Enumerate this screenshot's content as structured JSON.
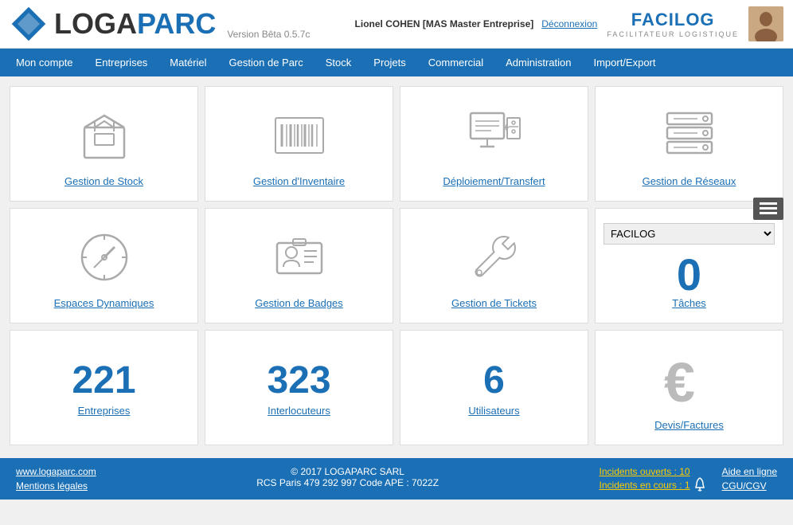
{
  "header": {
    "logo_text_loga": "LOGA",
    "logo_text_parc": "PARC",
    "version": "Version Bêta 0.5.7c",
    "user_name": "Lionel COHEN [MAS Master Entreprise]",
    "disconnect_label": "Déconnexion",
    "facilog_brand": "FACILOG",
    "facilog_sub": "FACILITATEUR LOGISTIQUE"
  },
  "nav": {
    "items": [
      "Mon compte",
      "Entreprises",
      "Matériel",
      "Gestion de Parc",
      "Stock",
      "Projets",
      "Commercial",
      "Administration",
      "Import/Export"
    ]
  },
  "tiles": {
    "row1": [
      {
        "label": "Gestion de Stock",
        "has_number": false
      },
      {
        "label": "Gestion d'Inventaire",
        "has_number": false
      },
      {
        "label": "Déploiement/Transfert",
        "has_number": false
      },
      {
        "label": "Gestion de Réseaux",
        "has_number": false
      }
    ],
    "row2": [
      {
        "label": "Espaces Dynamiques",
        "has_number": false
      },
      {
        "label": "Gestion de Badges",
        "has_number": false
      },
      {
        "label": "Gestion de Tickets",
        "has_number": false
      },
      {
        "label": "Tâches",
        "has_number": true,
        "number": "0",
        "dropdown": "FACILOG",
        "dropdown_options": [
          "FACILOG"
        ]
      }
    ],
    "row3": [
      {
        "label": "Entreprises",
        "has_number": true,
        "number": "221"
      },
      {
        "label": "Interlocuteurs",
        "has_number": true,
        "number": "323"
      },
      {
        "label": "Utilisateurs",
        "has_number": true,
        "number": "6"
      },
      {
        "label": "Devis/Factures",
        "has_number": false,
        "has_euro": true
      }
    ]
  },
  "footer": {
    "left_links": [
      "www.logaparc.com",
      "Mentions légales"
    ],
    "center_line1": "© 2017 LOGAPARC SARL",
    "center_line2": "RCS Paris 479 292 997  Code APE : 7022Z",
    "incidents_open": "Incidents ouverts : 10",
    "incidents_ongoing": "Incidents en cours : 1",
    "link_aide": "Aide en ligne",
    "link_cgu": "CGU/CGV"
  }
}
